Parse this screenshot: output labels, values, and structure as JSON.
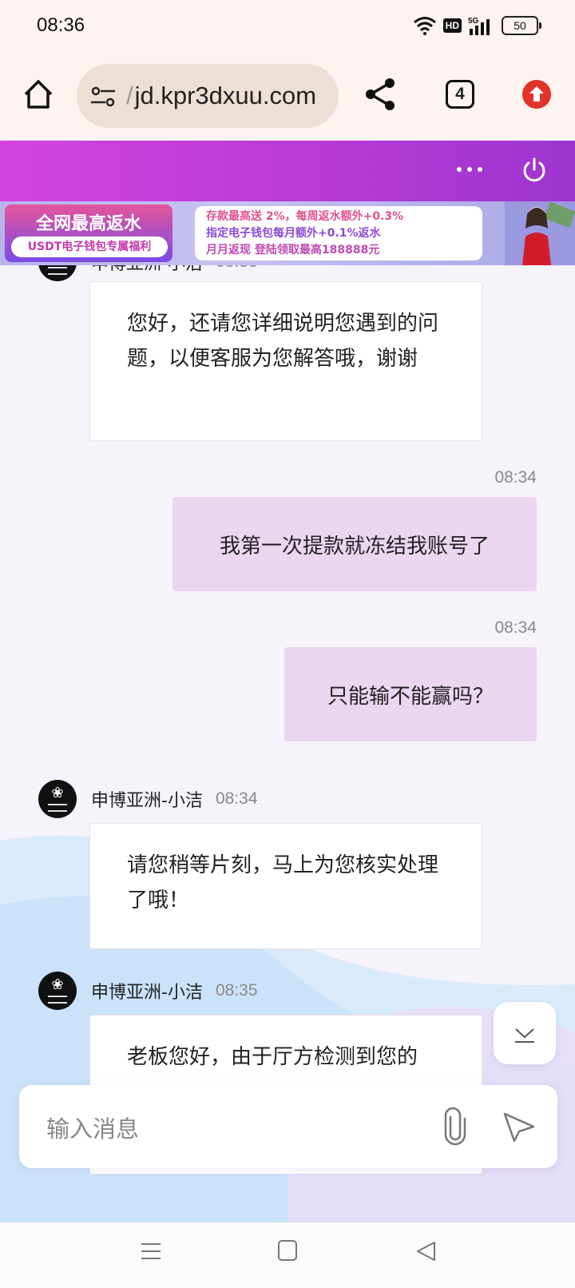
{
  "status_bar": {
    "time": "08:36",
    "hd": "HD",
    "network": "5G",
    "battery": "50"
  },
  "browser": {
    "url": "jd.kpr3dxuu.com",
    "tab_count": "4",
    "icons": [
      "home-icon",
      "site-settings-icon",
      "share-icon",
      "tabs-icon",
      "update-icon"
    ]
  },
  "site_header": {
    "icons": [
      "more-icon",
      "power-icon"
    ]
  },
  "banner": {
    "left_title": "全网最高返水",
    "left_subtitle": "USDT电子钱包专属福利",
    "line1": "存款最高送 2%，每周返水额外+0.3%",
    "line2": "指定电子钱包每月额外+0.1%返水",
    "line3": "月月返现 登陆领取最高188888元"
  },
  "chat": {
    "top_partial": {
      "sender": "申博亚洲-小洁",
      "time": "08:33",
      "text": "您好，还请您详细说明您遇到的问题，以便客服为您解答哦，谢谢"
    },
    "out1": {
      "time": "08:34",
      "text": "我第一次提款就冻结我账号了"
    },
    "out2": {
      "time": "08:34",
      "text": "只能输不能赢吗？"
    },
    "in2": {
      "sender": "申博亚洲-小洁",
      "time": "08:34",
      "text": "请您稍等片刻，马上为您核实处理了哦！"
    },
    "in3": {
      "sender": "申博亚洲-小洁",
      "time": "08:35",
      "text": "老板您好，由于厅方检测到您的"
    }
  },
  "input": {
    "placeholder": "输入消息"
  },
  "colors": {
    "header_gradient_start": "#d443e0",
    "header_gradient_end": "#9d34cf",
    "outgoing_bubble": "#ead6ee",
    "incoming_bubble": "#ffffff",
    "update_badge": "#e2322a"
  }
}
